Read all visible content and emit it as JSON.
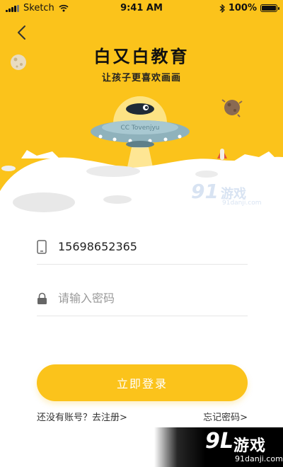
{
  "status_bar": {
    "carrier": "Sketch",
    "time": "9:41 AM",
    "battery": "100%",
    "battery_level": 1.0
  },
  "header": {
    "back_icon": "chevron-left-icon",
    "title": "白又白教育",
    "subtitle": "让孩子更喜欢画画"
  },
  "illustration": {
    "ufo_sign": "CC Tovenjyu"
  },
  "form": {
    "phone_value": "15698652365",
    "phone_icon": "phone-icon",
    "password_placeholder": "请输入密码",
    "password_icon": "lock-icon"
  },
  "actions": {
    "login_label": "立即登录",
    "register_label": "还没有账号？去注册>",
    "forgot_label": "忘记密码>"
  },
  "watermarks": {
    "top_logo": "91",
    "top_name": "游戏",
    "top_url": "91danji.com",
    "corner_logo": "9L",
    "corner_name": "游戏",
    "corner_url": "91danji.com"
  },
  "colors": {
    "accent": "#fbc31b",
    "text": "#222222",
    "placeholder": "#9a9a9a"
  }
}
